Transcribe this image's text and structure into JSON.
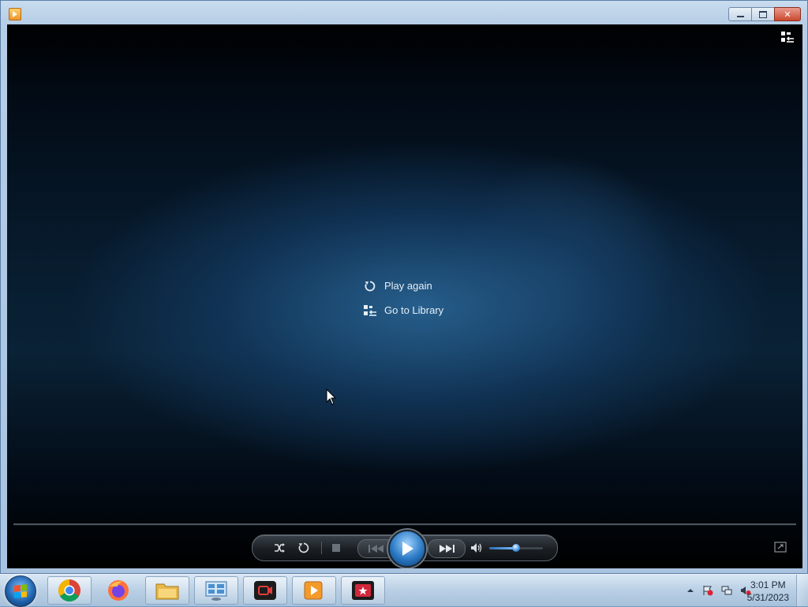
{
  "window": {
    "app_icon": "media-player-icon",
    "buttons": {
      "minimize": "minimize-icon",
      "maximize": "maximize-icon",
      "close": "✕"
    }
  },
  "player": {
    "menu": [
      {
        "icon": "replay-icon",
        "label": "Play again"
      },
      {
        "icon": "library-icon",
        "label": "Go to Library"
      }
    ],
    "controls": {
      "shuffle": "shuffle-icon",
      "repeat": "repeat-icon",
      "stop": "stop-icon",
      "previous": "previous-icon",
      "play": "play-icon",
      "next": "next-icon",
      "mute": "speaker-icon",
      "volume_level": 0.5
    },
    "accent_color": "#2a79c4"
  },
  "taskbar": {
    "apps": [
      "chrome-icon",
      "firefox-icon",
      "file-explorer-icon",
      "control-panel-icon",
      "screen-recorder-icon",
      "media-player-icon",
      "video-editor-icon"
    ],
    "clock": {
      "time": "3:01 PM",
      "date": "5/31/2023"
    }
  }
}
